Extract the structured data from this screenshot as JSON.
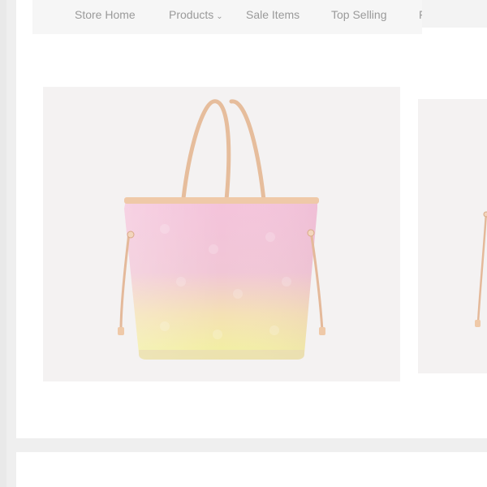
{
  "nav": {
    "items": [
      {
        "label": "Store Home"
      },
      {
        "label": "Products"
      },
      {
        "label": "Sale Items"
      },
      {
        "label": "Top Selling"
      },
      {
        "label": "Fe"
      }
    ]
  },
  "products": [
    {
      "image": "tote-bag-pastel-gradient"
    },
    {
      "image": "tote-bag-partial"
    }
  ],
  "colors": {
    "page_bg": "#efefef",
    "card_bg": "#ffffff",
    "tile_bg": "#f4f2f2",
    "bag_pink": "#f2c4d8",
    "bag_yellow": "#f3f2a6",
    "leather": "#e9c1a0"
  }
}
